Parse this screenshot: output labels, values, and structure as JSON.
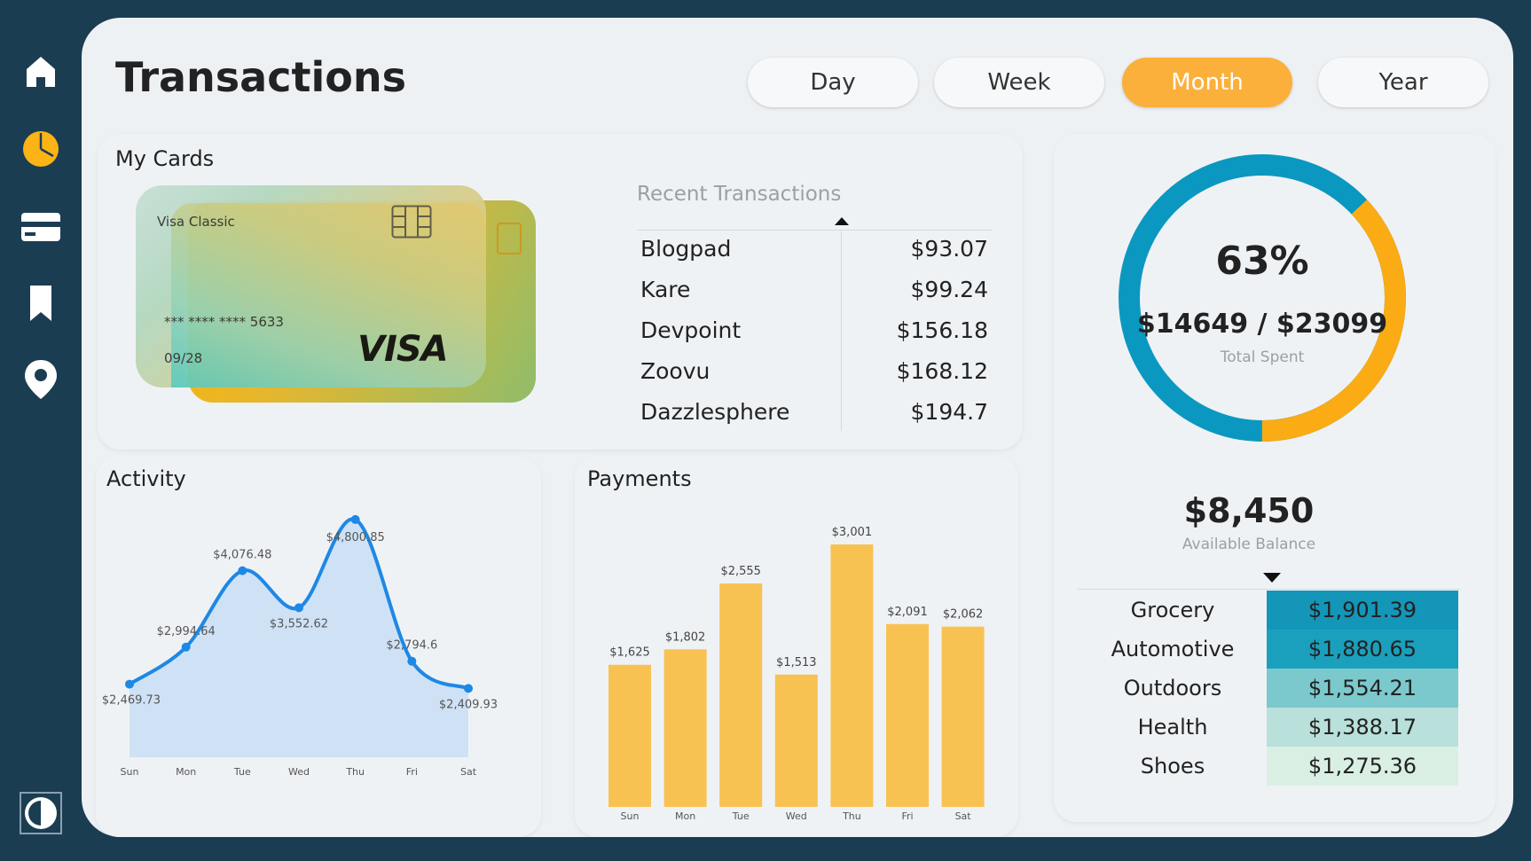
{
  "header": {
    "title": "Transactions"
  },
  "periods": [
    {
      "label": "Day",
      "active": false
    },
    {
      "label": "Week",
      "active": false
    },
    {
      "label": "Month",
      "active": true
    },
    {
      "label": "Year",
      "active": false
    }
  ],
  "sidebar": {
    "items": [
      {
        "icon": "home-icon"
      },
      {
        "icon": "pie-chart-icon"
      },
      {
        "icon": "credit-card-icon"
      },
      {
        "icon": "bookmark-icon"
      },
      {
        "icon": "location-pin-icon"
      }
    ],
    "bottom_icon": "contrast-toggle-icon"
  },
  "cards": {
    "title": "My Cards",
    "card_name": "Visa Classic",
    "card_number": "*** **** **** 5633",
    "expiry": "09/28",
    "brand": "VISA"
  },
  "recent_transactions": {
    "title": "Recent Transactions",
    "rows": [
      {
        "name": "Blogpad",
        "amount": "$93.07"
      },
      {
        "name": "Kare",
        "amount": "$99.24"
      },
      {
        "name": "Devpoint",
        "amount": "$156.18"
      },
      {
        "name": "Zoovu",
        "amount": "$168.12"
      },
      {
        "name": "Dazzlesphere",
        "amount": "$194.7"
      }
    ]
  },
  "summary": {
    "percent": "63%",
    "spent_ratio": "$14649 / $23099",
    "spent_label": "Total Spent",
    "balance": "$8,450",
    "balance_label": "Available Balance",
    "progress_fraction": 0.63,
    "colors": {
      "spent": "#0b98c0",
      "remaining": "#fbab13"
    }
  },
  "categories": [
    {
      "name": "Grocery",
      "amount": "$1,901.39",
      "color": "#1496b8"
    },
    {
      "name": "Automotive",
      "amount": "$1,880.65",
      "color": "#1aa0bd"
    },
    {
      "name": "Outdoors",
      "amount": "$1,554.21",
      "color": "#7bc9cc"
    },
    {
      "name": "Health",
      "amount": "$1,388.17",
      "color": "#b9e0da"
    },
    {
      "name": "Shoes",
      "amount": "$1,275.36",
      "color": "#d9efe4"
    }
  ],
  "chart_data": [
    {
      "type": "area",
      "title": "Activity",
      "categories": [
        "Sun",
        "Mon",
        "Tue",
        "Wed",
        "Thu",
        "Fri",
        "Sat"
      ],
      "values": [
        2469.73,
        2994.64,
        4076.48,
        3552.62,
        4800.85,
        2794.6,
        2409.93
      ],
      "labels": [
        "$2,469.73",
        "$2,994.64",
        "$4,076.48",
        "$3,552.62",
        "$4,800.85",
        "$2,794.6",
        "$2,409.93"
      ],
      "ylim": [
        2000,
        4850
      ],
      "color": "#1e88e5",
      "fill": "#cfe2f5"
    },
    {
      "type": "bar",
      "title": "Payments",
      "categories": [
        "Sun",
        "Mon",
        "Tue",
        "Wed",
        "Thu",
        "Fri",
        "Sat"
      ],
      "values": [
        1625,
        1802,
        2555,
        1513,
        3001,
        2091,
        2062
      ],
      "labels": [
        "$1,625",
        "$1,802",
        "$2,555",
        "$1,513",
        "$3,001",
        "$2,091",
        "$2,062"
      ],
      "ylim": [
        0,
        3001
      ],
      "color": "#f8c253"
    }
  ]
}
